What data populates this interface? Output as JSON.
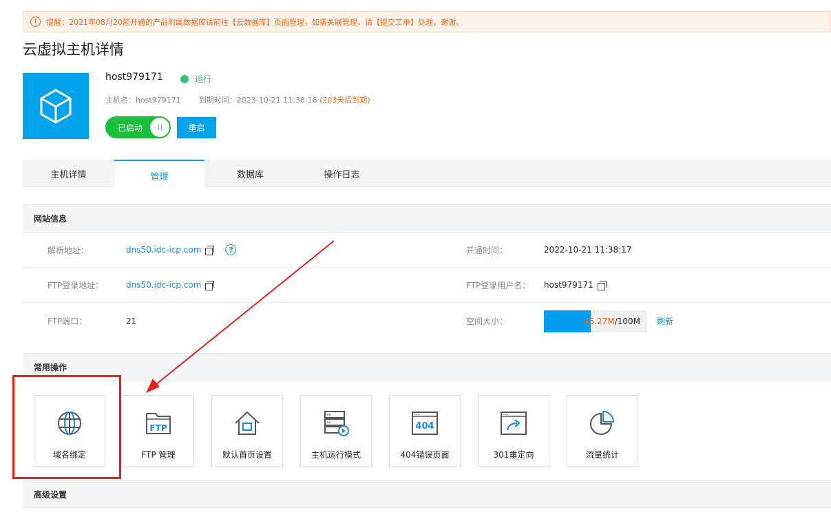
{
  "notice": {
    "icon": "warning-circle-icon",
    "text": "提醒：2021年08月20前开通的产品附属数据库请前往【云数据库】页面管理，如需关联管理，请【提交工单】处理，谢谢。"
  },
  "page_title": "云虚拟主机详情",
  "host": {
    "logo_icon": "cube-icon",
    "name": "host979171",
    "status": "运行",
    "hostname_label": "主机名：",
    "hostname": "host979171",
    "expire_label": "到期时间：",
    "expire_time": "2023-10-21 11:38:16",
    "expire_note": "(203天后到期)",
    "toggle_label": "已启动",
    "restart_label": "重启"
  },
  "tabs": [
    {
      "label": "主机详情",
      "active": false
    },
    {
      "label": "管理",
      "active": true
    },
    {
      "label": "数据库",
      "active": false
    },
    {
      "label": "操作日志",
      "active": false
    }
  ],
  "site_info": {
    "title": "网站信息",
    "rows": [
      {
        "label": "解析地址：",
        "value": "dns50.idc-icp.com",
        "label2": "开通时间：",
        "value2": "2022-10-21 11:38:17"
      },
      {
        "label": "FTP登录地址：",
        "value": "dns50.idc-icp.com",
        "label2": "FTP登录用户名：",
        "value2": "host979171"
      },
      {
        "label": "FTP端口：",
        "value": "21",
        "label2": "空间大小：",
        "value2": ""
      }
    ],
    "space": {
      "used": "45.27M",
      "separator": "/",
      "total": "100M",
      "used_fraction": 0.4527,
      "refresh_label": "刷新"
    }
  },
  "common_ops": {
    "title": "常用操作",
    "items": [
      {
        "label": "域名绑定",
        "icon": "globe-icon"
      },
      {
        "label": "FTP 管理",
        "icon": "ftp-folder-icon"
      },
      {
        "label": "默认首页设置",
        "icon": "home-icon"
      },
      {
        "label": "主机运行模式",
        "icon": "server-play-icon"
      },
      {
        "label": "404错误页面",
        "icon": "404-page-icon"
      },
      {
        "label": "301重定向",
        "icon": "redirect-icon"
      },
      {
        "label": "流量统计",
        "icon": "pie-chart-icon"
      }
    ]
  },
  "advanced": {
    "title": "高级设置"
  },
  "colors": {
    "accent": "#00a2ea",
    "running": "#2dc56f",
    "toggle_on": "#19be3a",
    "warning": "#e8681f",
    "annotation": "#e8201c"
  }
}
